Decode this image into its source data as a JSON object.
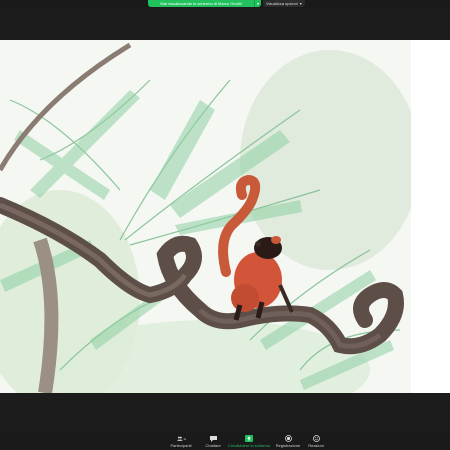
{
  "top_bar": {
    "share_banner": "Stai visualizzando lo schermo di Marco Gentili",
    "view_options": "Visualizza opzioni"
  },
  "toolbar": {
    "participants_count": "114",
    "participants_label": "Partecipanti",
    "chat_label": "Chattare",
    "share_label": "Condividere lo schermo",
    "record_label": "Registrazione",
    "reactions_label": "Reazioni",
    "accent_color": "#21c25e"
  },
  "shared_content": {
    "description_icon": "photo-red-lemur-on-vine"
  }
}
